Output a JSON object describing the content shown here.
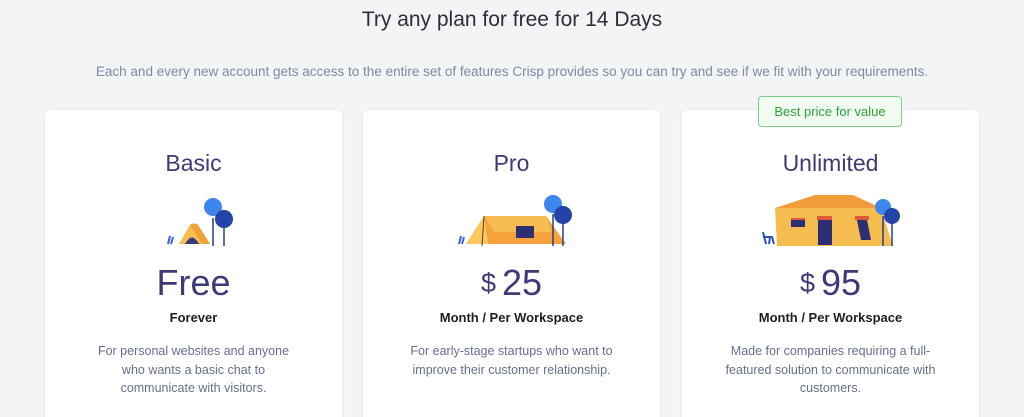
{
  "header": {
    "title": "Try any plan for free for 14 Days",
    "subtitle": "Each and every new account gets access to the entire set of features Crisp provides so you can try and see if we fit with your requirements."
  },
  "plans": [
    {
      "name": "Basic",
      "currency": "",
      "price": "Free",
      "period": "Forever",
      "description": "For personal websites and anyone who wants a basic chat to communicate with visitors.",
      "illustration": "small-tent-icon"
    },
    {
      "name": "Pro",
      "currency": "$",
      "price": "25",
      "period": "Month / Per Workspace",
      "description": "For early-stage startups who want to improve their customer relationship.",
      "illustration": "large-tent-icon"
    },
    {
      "name": "Unlimited",
      "currency": "$",
      "price": "95",
      "period": "Month / Per Workspace",
      "description": "Made for companies requiring a full-featured solution to communicate with customers.",
      "badge": "Best price for value",
      "illustration": "cabin-icon"
    }
  ],
  "colors": {
    "background": "#f3f4f6",
    "accent_purple": "#3d3a78",
    "tent_orange": "#f3b74c",
    "tree_blue": "#2f7ae8",
    "badge_green": "#2fa23c"
  }
}
